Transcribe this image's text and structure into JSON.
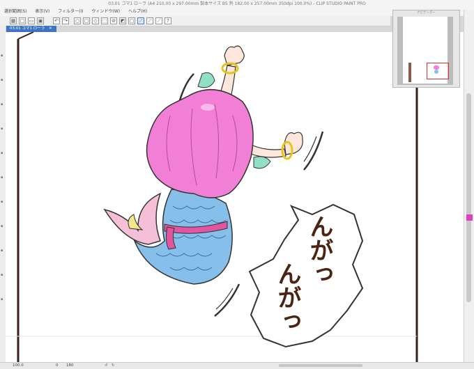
{
  "window": {
    "title": "03.01 コマ1 ローラ (A4 210.00 x 297.00mm 製本サイズ B5 判 182.00 x 257.00mm 350dpi 100.0%) - CLIP STUDIO PAINT PRO"
  },
  "menu": [
    "選択範囲(S)",
    "表示(V)",
    "フィルター(I)",
    "ウィンドウ(W)",
    "ヘルプ(H)"
  ],
  "tab": {
    "label": "03.01 コマ1 ローラ"
  },
  "navigator": {
    "title": "ナビゲーター"
  },
  "speech_bubble": {
    "line1": "んがっ",
    "line2": "んがっ"
  },
  "status": {
    "zoom": "100.0",
    "page": "0",
    "rotation": "180"
  },
  "colors": {
    "accent": "#3d74c4",
    "hair": "#f27fd6",
    "tail": "#7fb8e6",
    "sash": "#e0569f",
    "magenta_swatch": "#e040c0"
  }
}
